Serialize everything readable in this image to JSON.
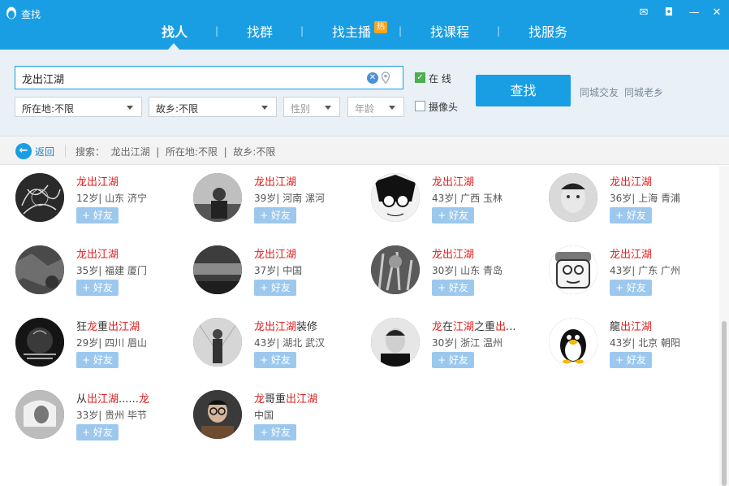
{
  "window": {
    "title": "查找",
    "controls": [
      {
        "name": "feedback",
        "glyph": "✉"
      },
      {
        "name": "lock",
        "glyph": "◘"
      },
      {
        "name": "minimize",
        "glyph": "—"
      },
      {
        "name": "close",
        "glyph": "✕"
      }
    ]
  },
  "tabs": [
    {
      "label": "找人",
      "active": true
    },
    {
      "label": "找群",
      "active": false
    },
    {
      "label": "找主播",
      "active": false,
      "badge": "热"
    },
    {
      "label": "找课程",
      "active": false
    },
    {
      "label": "找服务",
      "active": false
    }
  ],
  "tab_separator": "|",
  "search": {
    "keyword": "龙出江湖",
    "location_select": "所在地:不限",
    "hometown_select": "故乡:不限",
    "gender_placeholder": "性别",
    "age_placeholder": "年龄",
    "online_label": "在  线",
    "online_checked": true,
    "camera_label": "摄像头",
    "camera_checked": false,
    "find_button": "查找",
    "links": [
      "同城交友",
      "同城老乡"
    ]
  },
  "crumb": {
    "back_label": "返回",
    "text": "搜索：  龙出江湖  |  所在地:不限  |  故乡:不限"
  },
  "results": [
    {
      "nick": [
        [
          "hl",
          "龙出江湖"
        ]
      ],
      "info": "12岁| 山东 济宁",
      "avatar": "sketch"
    },
    {
      "nick": [
        [
          "hl",
          "龙出江湖"
        ]
      ],
      "info": "39岁| 河南 漯河",
      "avatar": "person-light"
    },
    {
      "nick": [
        [
          "hl",
          "龙出江湖"
        ]
      ],
      "info": "43岁| 广西 玉林",
      "avatar": "anime"
    },
    {
      "nick": [
        [
          "hl",
          "龙出江湖"
        ]
      ],
      "info": "36岁| 上海 青浦",
      "avatar": "face-light"
    },
    {
      "nick": [
        [
          "hl",
          "龙出江湖"
        ]
      ],
      "info": "35岁| 福建 厦门",
      "avatar": "dark-texture"
    },
    {
      "nick": [
        [
          "hl",
          "龙出江湖"
        ]
      ],
      "info": "37岁| 中国",
      "avatar": "car-dark"
    },
    {
      "nick": [
        [
          "hl",
          "龙出江湖"
        ]
      ],
      "info": "30岁| 山东 青岛",
      "avatar": "plants"
    },
    {
      "nick": [
        [
          "hl",
          "龙出江湖"
        ]
      ],
      "info": "43岁| 广东 广州",
      "avatar": "cartoon"
    },
    {
      "nick": [
        [
          "n",
          "狂"
        ],
        [
          "hl",
          "龙"
        ],
        [
          "n",
          "重"
        ],
        [
          "hl",
          "出江湖"
        ]
      ],
      "info": "29岁| 四川 眉山",
      "avatar": "poster-dark"
    },
    {
      "nick": [
        [
          "hl",
          "龙出江湖"
        ],
        [
          "n",
          "装修"
        ]
      ],
      "info": "43岁| 湖北 武汉",
      "avatar": "person-gray"
    },
    {
      "nick": [
        [
          "hl",
          "龙"
        ],
        [
          "n",
          "在"
        ],
        [
          "hl",
          "江湖"
        ],
        [
          "n",
          "之重"
        ],
        [
          "hl",
          "出"
        ],
        [
          "n",
          "..."
        ]
      ],
      "info": "30岁| 浙江 温州",
      "avatar": "man-black"
    },
    {
      "nick": [
        [
          "n",
          "龍"
        ],
        [
          "hl",
          "出江湖"
        ]
      ],
      "info": "43岁| 北京 朝阳",
      "avatar": "penguin"
    },
    {
      "nick": [
        [
          "n",
          "从"
        ],
        [
          "hl",
          "出江湖"
        ],
        [
          "n",
          "......"
        ],
        [
          "hl",
          "龙"
        ]
      ],
      "info": "33岁| 贵州 毕节",
      "avatar": "bw-person"
    },
    {
      "nick": [
        [
          "hl",
          "龙"
        ],
        [
          "n",
          "哥重"
        ],
        [
          "hl",
          "出江湖"
        ]
      ],
      "info": "中国",
      "avatar": "glasses-man"
    }
  ],
  "add_friend_label": "+ 好友",
  "colors": {
    "brand": "#1a9ee3",
    "highlight": "#e02020",
    "add_button": "#9dc8ee"
  }
}
